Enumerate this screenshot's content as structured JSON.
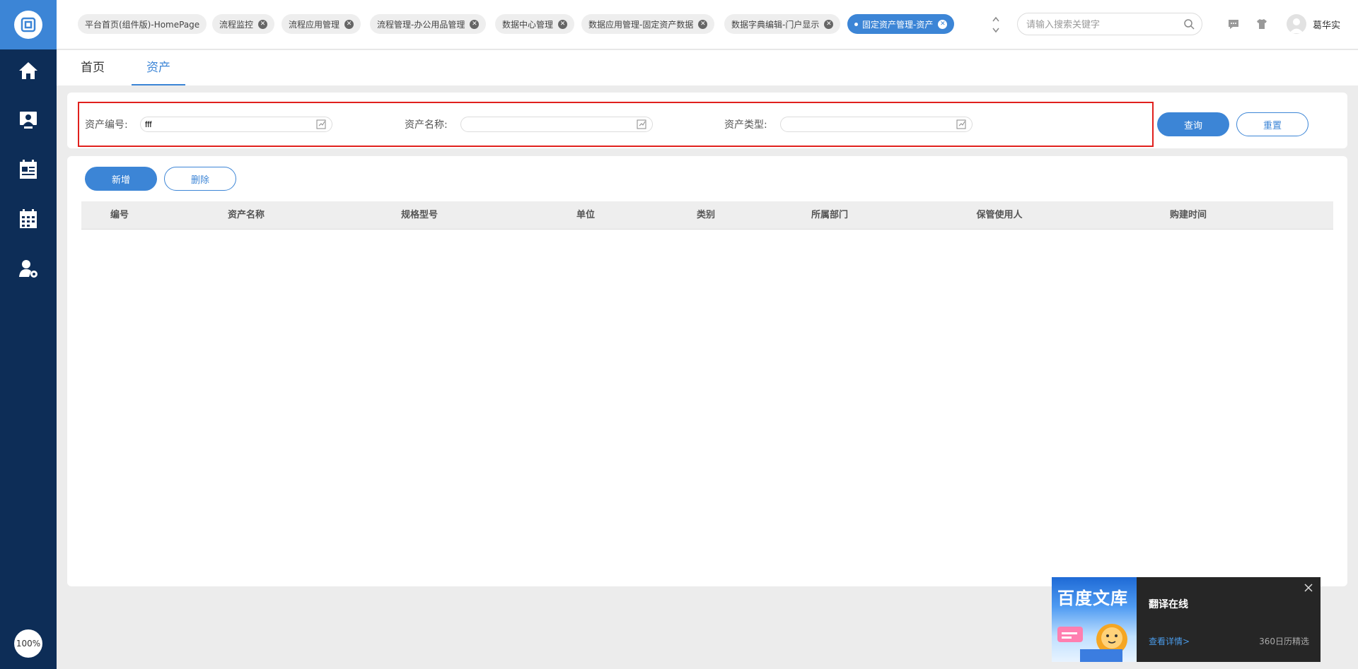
{
  "sidebar": {
    "nav_items": [
      {
        "icon": "home-icon"
      },
      {
        "icon": "monitor-user-icon"
      },
      {
        "icon": "calendar-list-icon"
      },
      {
        "icon": "calendar-grid-icon"
      },
      {
        "icon": "user-settings-icon"
      }
    ],
    "zoom": "100%"
  },
  "tabs": [
    {
      "label": "平台首页(组件版)-HomePage"
    },
    {
      "label": "流程监控"
    },
    {
      "label": "流程应用管理"
    },
    {
      "label": "流程管理-办公用品管理"
    },
    {
      "label": "数据中心管理"
    },
    {
      "label": "数据应用管理-固定资产数据"
    },
    {
      "label": "数据字典编辑-门户显示"
    },
    {
      "label": "固定资产管理-资产",
      "active": true
    }
  ],
  "search": {
    "placeholder": "请输入搜索关键字"
  },
  "user": {
    "name": "葛华实"
  },
  "subtabs": [
    {
      "label": "首页"
    },
    {
      "label": "资产",
      "active": true
    }
  ],
  "filter": {
    "asset_code_label": "资产编号:",
    "asset_code_value": "fff",
    "asset_name_label": "资产名称:",
    "asset_name_value": "",
    "asset_type_label": "资产类型:",
    "asset_type_value": "",
    "query_label": "查询",
    "reset_label": "重置"
  },
  "toolbar": {
    "add_label": "新增",
    "delete_label": "删除"
  },
  "table": {
    "columns": [
      "编号",
      "资产名称",
      "规格型号",
      "单位",
      "类别",
      "所属部门",
      "保管使用人",
      "购建时间"
    ],
    "rows": []
  },
  "ad": {
    "brand": "百度文库",
    "title": "翻译在线",
    "link": "查看详情>",
    "source": "360日历精选"
  },
  "colors": {
    "sidebar": "#0d2d57",
    "accent": "#3c85d6",
    "highlight_border": "#e0201d"
  }
}
